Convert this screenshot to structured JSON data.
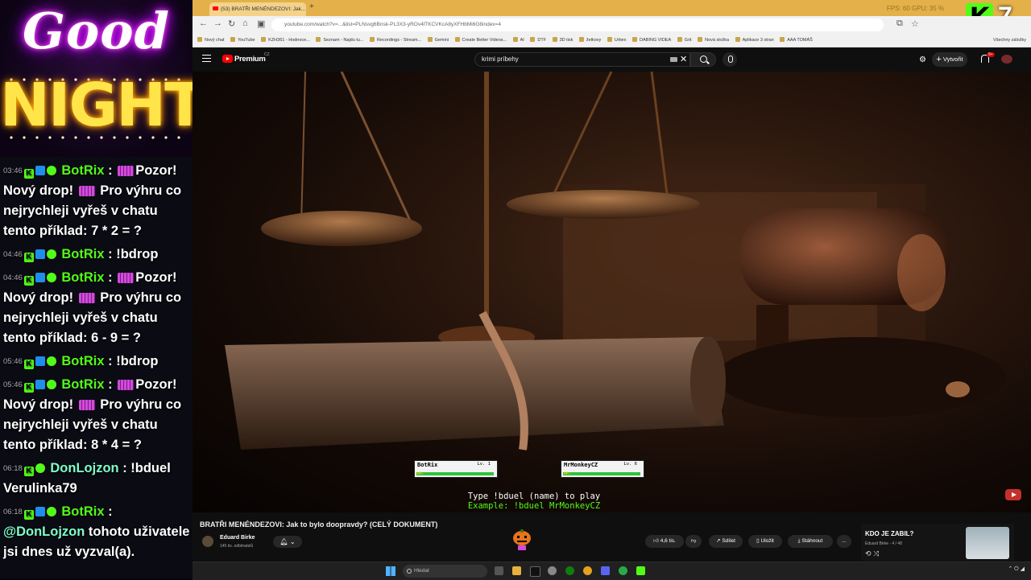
{
  "banner": {
    "line1": "Good",
    "line2": "NIGHT"
  },
  "chat": [
    {
      "time": "03:46",
      "user": "BotRix",
      "user_class": "bot",
      "sep": " : ",
      "emote": true,
      "first": "Pozor!",
      "rest": "Nový drop! ",
      "emote2": true,
      "rest2": " Pro výhru co nejrychleji vyřeš v chatu tento příklad: 7 * 2 = ?"
    },
    {
      "time": "04:46",
      "user": "BotRix",
      "user_class": "bot",
      "sep": " : ",
      "emote": false,
      "first": "!bdrop",
      "rest": "",
      "emote2": false,
      "rest2": ""
    },
    {
      "time": "04:46",
      "user": "BotRix",
      "user_class": "bot",
      "sep": " : ",
      "emote": true,
      "first": "Pozor!",
      "rest": "Nový drop! ",
      "emote2": true,
      "rest2": " Pro výhru co nejrychleji vyřeš v chatu tento příklad: 6 - 9 = ?"
    },
    {
      "time": "05:46",
      "user": "BotRix",
      "user_class": "bot",
      "sep": " : ",
      "emote": false,
      "first": "!bdrop",
      "rest": "",
      "emote2": false,
      "rest2": ""
    },
    {
      "time": "05:46",
      "user": "BotRix",
      "user_class": "bot",
      "sep": " : ",
      "emote": true,
      "first": "Pozor!",
      "rest": "Nový drop! ",
      "emote2": true,
      "rest2": " Pro výhru co nejrychleji vyřeš v chatu tento příklad: 8 * 4 = ?"
    },
    {
      "time": "06:18",
      "user": "DonLojzon",
      "user_class": "don",
      "sep": " : ",
      "emote": false,
      "first": "!bduel Verulinka79",
      "rest": "",
      "emote2": false,
      "rest2": ""
    },
    {
      "time": "06:18",
      "user": "BotRix",
      "user_class": "bot",
      "sep": " :",
      "emote": false,
      "first": "",
      "rest": "@DonLojzon",
      "emote2": false,
      "rest2": " tohoto uživatele jsi dnes už vyzval(a)."
    }
  ],
  "browser": {
    "tab_title": "(53) BRATŘI MENÉNDEZOVI: Jak...",
    "win_stats": "FPS: 60   GPU: 35 %",
    "url": "youtube.com/watch?v=...&list=PLNsvg6Bnsk-PL3X3-yROv4lTKCVKcA8yXFHbMi6G8index=4",
    "bookmarks": [
      "Nový chat",
      "YouTube",
      "KZH361 - Hodnoce...",
      "Seznam - Najdu tu...",
      "Recordings - Stream...",
      "Gemini",
      "Create Better Videos...",
      "AI",
      "DTF",
      "3D tisk",
      "želkovy",
      "Urbex",
      "DABING VIDEA",
      "Grit",
      "Nová složka",
      "Aplikace 3 stran",
      "AAA TOMÁŠ"
    ],
    "bookmarks_all": "Všechny záložky"
  },
  "kick": {
    "logo": "K",
    "number": "7"
  },
  "youtube": {
    "brand": "Premium",
    "country": "CZ",
    "search_value": "krimi príbehy",
    "create_label": "Vytvořit",
    "notif_count": "9+",
    "video_title": "BRATŘI MENÉNDEZOVI: Jak to bylo doopravdy? (CELÝ DOKUMENT)",
    "channel_name": "Eduard Birke",
    "channel_subs": "145 tis. odběratelů",
    "likes": "4,6 tis.",
    "share": "Sdílet",
    "save": "Uložit",
    "download": "Stáhnout",
    "more": "...",
    "side_title": "KDO JE ZABIL?",
    "side_sub": "Eduard Birke - 4 / 48"
  },
  "duel": {
    "p1_name": "BotRix",
    "p1_level": "Lv. 1",
    "p1_hp": 1.0,
    "p2_name": "MrMonkeyCZ",
    "p2_level": "Lv. 6",
    "p2_hp": 1.0,
    "hp_label": "HP:",
    "line1": "Type !bduel (name) to play",
    "line2": "Example: !bduel MrMonkeyCZ"
  },
  "taskbar": {
    "search_placeholder": "Hledat"
  },
  "colors": {
    "kick_green": "#53fc18",
    "youtube_red": "#ff0000",
    "chat_bg": "#0b0b14",
    "browser_tab": "#e3b04a"
  }
}
